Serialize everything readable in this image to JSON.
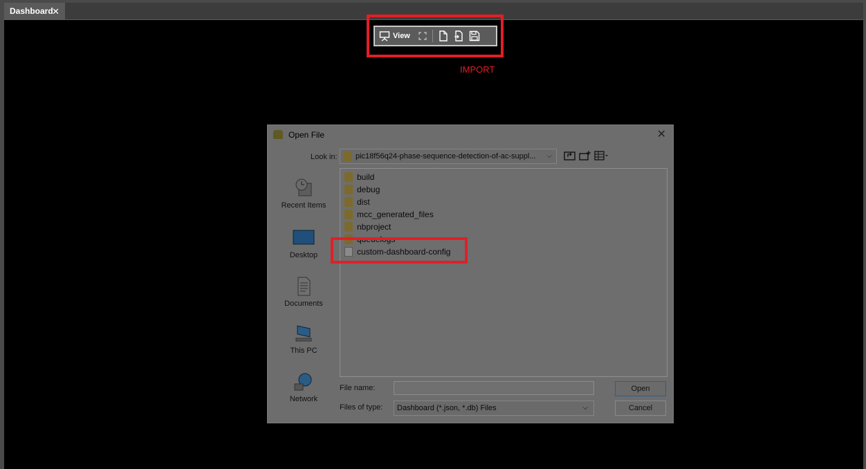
{
  "tab": {
    "title": "Dashboard",
    "close": "✕"
  },
  "toolbar": {
    "view_label": "View"
  },
  "annotation": {
    "import_label": "IMPORT",
    "color": "#e21e26"
  },
  "dialog": {
    "title": "Open File",
    "close": "✕",
    "look_in_label": "Look in:",
    "look_in_value": "pic18f56q24-phase-sequence-detection-of-ac-suppl...",
    "places": [
      {
        "label": "Recent Items",
        "icon": "recent-items-icon"
      },
      {
        "label": "Desktop",
        "icon": "desktop-icon"
      },
      {
        "label": "Documents",
        "icon": "documents-icon"
      },
      {
        "label": "This PC",
        "icon": "computer-icon"
      },
      {
        "label": "Network",
        "icon": "network-icon"
      }
    ],
    "files": [
      {
        "name": "build",
        "type": "folder"
      },
      {
        "name": "debug",
        "type": "folder"
      },
      {
        "name": "dist",
        "type": "folder"
      },
      {
        "name": "mcc_generated_files",
        "type": "folder"
      },
      {
        "name": "nbproject",
        "type": "folder"
      },
      {
        "name": "queuelogs",
        "type": "folder"
      },
      {
        "name": "custom-dashboard-config",
        "type": "file"
      }
    ],
    "file_name_label": "File name:",
    "file_name_value": "",
    "files_of_type_label": "Files of type:",
    "files_of_type_value": "Dashboard (*.json, *.db) Files",
    "open_label": "Open",
    "cancel_label": "Cancel"
  }
}
